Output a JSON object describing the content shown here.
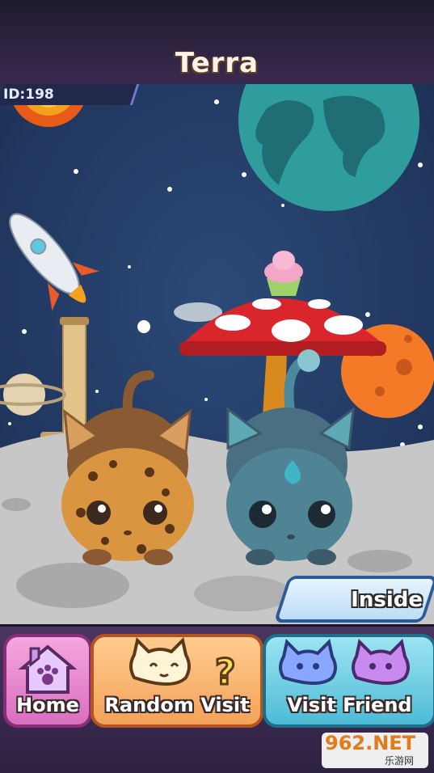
{
  "header": {
    "title": "Terra"
  },
  "player": {
    "id_label": "ID:198"
  },
  "scene": {
    "inside_label": "Inside",
    "sky_color": "#213a63",
    "ground_color": "#c7c7c7",
    "objects": [
      "sun",
      "earth",
      "rocket",
      "scratching-post",
      "saturn",
      "mushroom-table",
      "cupcake",
      "orange-planet",
      "cookie-cat",
      "blue-cat"
    ]
  },
  "nav": {
    "home_label": "Home",
    "random_label": "Random Visit",
    "friend_label": "Visit Friend"
  },
  "watermark": {
    "main": "962.NET",
    "sub": "乐游网"
  }
}
